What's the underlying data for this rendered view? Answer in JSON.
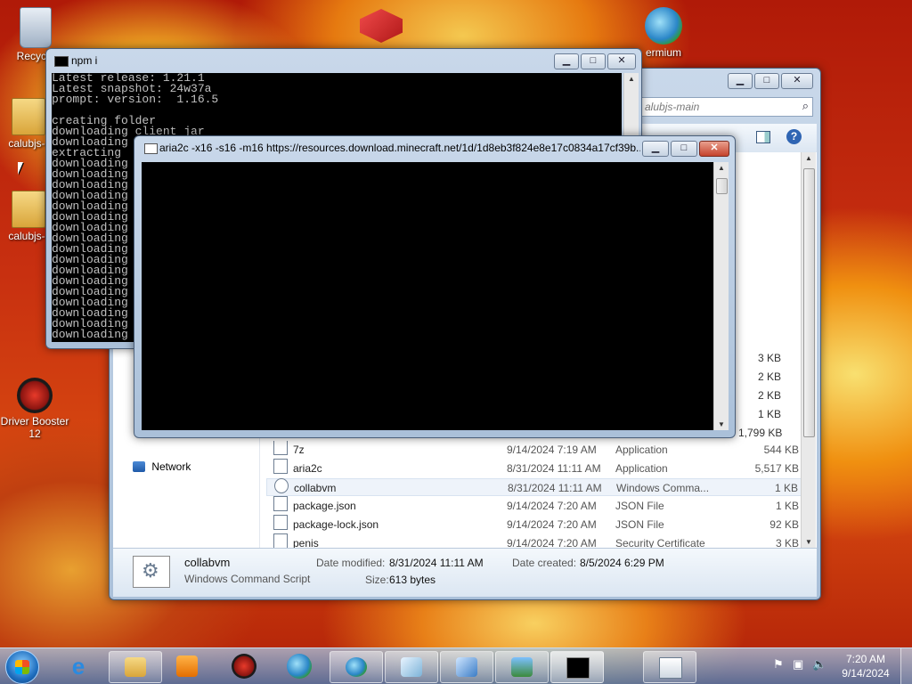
{
  "desktop": {
    "icons": [
      {
        "label": "Recycle"
      },
      {
        "label": "calubjs-r"
      },
      {
        "label": "calubjs-r"
      },
      {
        "label": "Driver Booster 12"
      },
      {
        "label": "ermium"
      }
    ]
  },
  "explorer": {
    "address_text": "alubjs-main",
    "nav_network": "Network",
    "partial_sizes": [
      "3 KB",
      "2 KB",
      "2 KB",
      "1 KB",
      "1,799 KB"
    ],
    "files": [
      {
        "name": "7z",
        "date": "9/14/2024 7:19 AM",
        "type": "Application",
        "size": "544 KB"
      },
      {
        "name": "aria2c",
        "date": "8/31/2024 11:11 AM",
        "type": "Application",
        "size": "5,517 KB"
      },
      {
        "name": "collabvm",
        "date": "8/31/2024 11:11 AM",
        "type": "Windows Comma...",
        "size": "1 KB"
      },
      {
        "name": "package.json",
        "date": "9/14/2024 7:20 AM",
        "type": "JSON File",
        "size": "1 KB"
      },
      {
        "name": "package-lock.json",
        "date": "9/14/2024 7:20 AM",
        "type": "JSON File",
        "size": "92 KB"
      },
      {
        "name": "penis",
        "date": "9/14/2024 7:20 AM",
        "type": "Security Certificate",
        "size": "3 KB"
      }
    ],
    "details": {
      "name": "collabvm",
      "type": "Windows Command Script",
      "modified_label": "Date modified:",
      "modified_value": "8/31/2024 11:11 AM",
      "size_label": "Size:",
      "size_value": "613 bytes",
      "created_label": "Date created:",
      "created_value": "8/5/2024 6:29 PM"
    }
  },
  "npm_window": {
    "title": "npm i",
    "lines": [
      "Latest release: 1.21.1",
      "Latest snapshot: 24w37a",
      "prompt: version:  1.16.5",
      "",
      "creating folder",
      "downloading client jar",
      "downloading",
      "extracting",
      "downloading",
      "downloading",
      "downloading",
      "downloading",
      "downloading",
      "downloading",
      "downloading",
      "downloading",
      "downloading",
      "downloading",
      "downloading",
      "downloading",
      "downloading",
      "downloading",
      "downloading",
      "downloading",
      "downloading"
    ]
  },
  "aria_window": {
    "title": "aria2c  -x16 -s16 -m16 https://resources.download.minecraft.net/1d/1d8eb3f824e8e17c0834a17cf39b..."
  },
  "taskbar": {
    "clock_time": "7:20 AM",
    "clock_date": "9/14/2024"
  },
  "colors": {
    "explorer_bg": "#ffffff",
    "console_bg": "#000000",
    "console_fg": "#c0c0c0",
    "title_glass": "#aac0d9"
  }
}
